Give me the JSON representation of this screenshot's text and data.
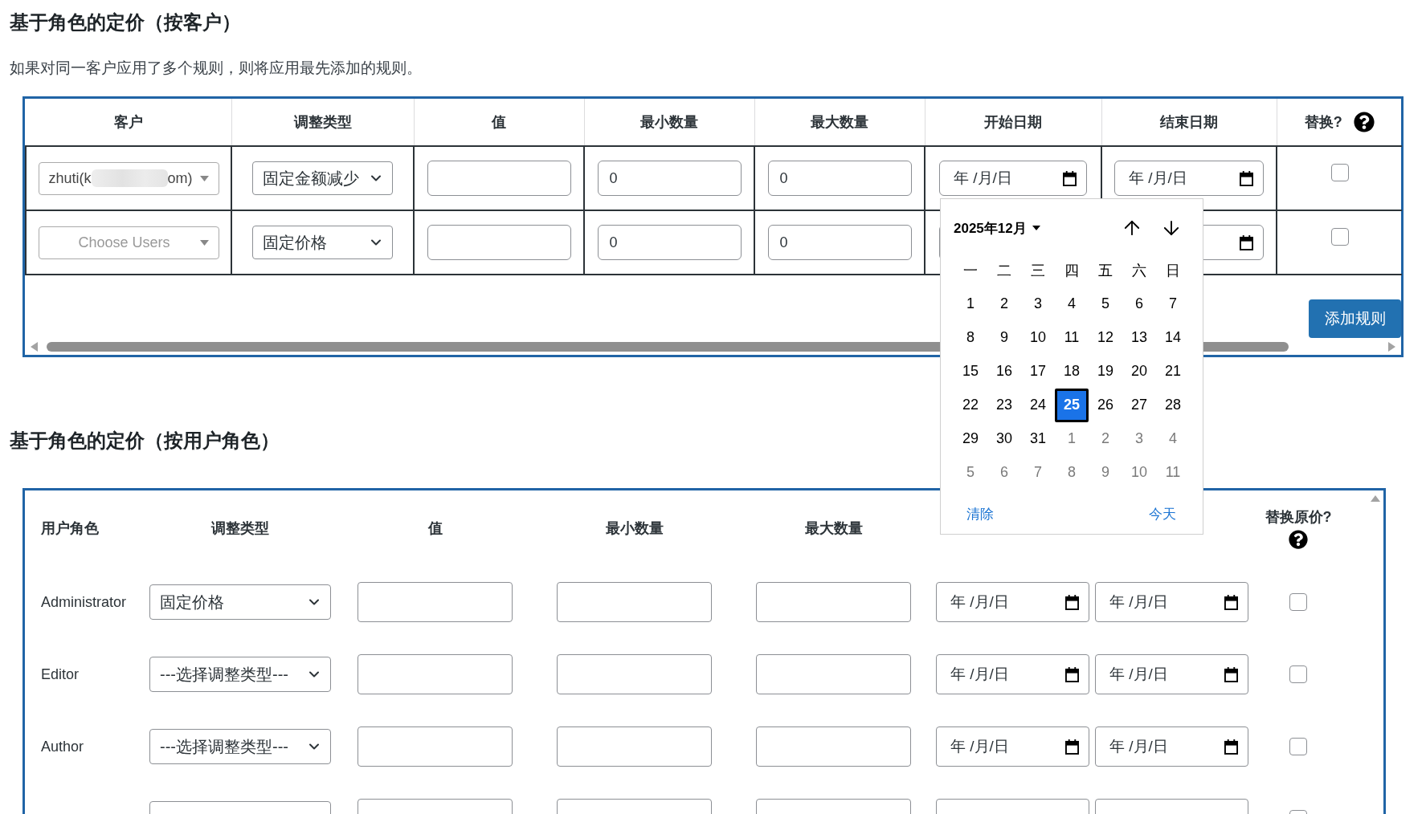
{
  "customer_pricing": {
    "title": "基于角色的定价（按客户）",
    "note": "如果对同一客户应用了多个规则，则将应用最先添加的规则。",
    "columns": [
      {
        "label": "客户",
        "help": false
      },
      {
        "label": "调整类型",
        "help": false
      },
      {
        "label": "值",
        "help": false
      },
      {
        "label": "最小数量",
        "help": false
      },
      {
        "label": "最大数量",
        "help": false
      },
      {
        "label": "开始日期",
        "help": false
      },
      {
        "label": "结束日期",
        "help": false
      },
      {
        "label": "替换?",
        "help": true
      }
    ],
    "rows": [
      {
        "customer": {
          "text_start": "zhuti(k",
          "redacted": true,
          "text_end": "om)"
        },
        "adjustment": "固定金额减少",
        "min_qty": "0",
        "max_qty": "0",
        "start_date": "年 /月/日",
        "end_date": "年 /月/日",
        "replace": false
      },
      {
        "customer": {
          "placeholder": "Choose Users"
        },
        "adjustment": "固定价格",
        "min_qty": "0",
        "max_qty": "0",
        "replace": false
      }
    ],
    "add_button": "添加规则"
  },
  "date_picker": {
    "month": "2025年12月",
    "weekdays": [
      "一",
      "二",
      "三",
      "四",
      "五",
      "六",
      "日"
    ],
    "days": [
      {
        "label": "1",
        "outside": false,
        "selected": false
      },
      {
        "label": "2",
        "outside": false,
        "selected": false
      },
      {
        "label": "3",
        "outside": false,
        "selected": false
      },
      {
        "label": "4",
        "outside": false,
        "selected": false
      },
      {
        "label": "5",
        "outside": false,
        "selected": false
      },
      {
        "label": "6",
        "outside": false,
        "selected": false
      },
      {
        "label": "7",
        "outside": false,
        "selected": false
      },
      {
        "label": "8",
        "outside": false,
        "selected": false
      },
      {
        "label": "9",
        "outside": false,
        "selected": false
      },
      {
        "label": "10",
        "outside": false,
        "selected": false
      },
      {
        "label": "11",
        "outside": false,
        "selected": false
      },
      {
        "label": "12",
        "outside": false,
        "selected": false
      },
      {
        "label": "13",
        "outside": false,
        "selected": false
      },
      {
        "label": "14",
        "outside": false,
        "selected": false
      },
      {
        "label": "15",
        "outside": false,
        "selected": false
      },
      {
        "label": "16",
        "outside": false,
        "selected": false
      },
      {
        "label": "17",
        "outside": false,
        "selected": false
      },
      {
        "label": "18",
        "outside": false,
        "selected": false
      },
      {
        "label": "19",
        "outside": false,
        "selected": false
      },
      {
        "label": "20",
        "outside": false,
        "selected": false
      },
      {
        "label": "21",
        "outside": false,
        "selected": false
      },
      {
        "label": "22",
        "outside": false,
        "selected": false
      },
      {
        "label": "23",
        "outside": false,
        "selected": false
      },
      {
        "label": "24",
        "outside": false,
        "selected": false
      },
      {
        "label": "25",
        "outside": false,
        "selected": true
      },
      {
        "label": "26",
        "outside": false,
        "selected": false
      },
      {
        "label": "27",
        "outside": false,
        "selected": false
      },
      {
        "label": "28",
        "outside": false,
        "selected": false
      },
      {
        "label": "29",
        "outside": false,
        "selected": false
      },
      {
        "label": "30",
        "outside": false,
        "selected": false
      },
      {
        "label": "31",
        "outside": false,
        "selected": false
      },
      {
        "label": "1",
        "outside": true,
        "selected": false
      },
      {
        "label": "2",
        "outside": true,
        "selected": false
      },
      {
        "label": "3",
        "outside": true,
        "selected": false
      },
      {
        "label": "4",
        "outside": true,
        "selected": false
      },
      {
        "label": "5",
        "outside": true,
        "selected": false
      },
      {
        "label": "6",
        "outside": true,
        "selected": false
      },
      {
        "label": "7",
        "outside": true,
        "selected": false
      },
      {
        "label": "8",
        "outside": true,
        "selected": false
      },
      {
        "label": "9",
        "outside": true,
        "selected": false
      },
      {
        "label": "10",
        "outside": true,
        "selected": false
      },
      {
        "label": "11",
        "outside": true,
        "selected": false
      }
    ],
    "clear": "清除",
    "today": "今天"
  },
  "role_pricing": {
    "title": "基于角色的定价（按用户角色）",
    "columns": [
      {
        "label": "用户角色",
        "help": false
      },
      {
        "label": "调整类型",
        "help": false
      },
      {
        "label": "值",
        "help": false
      },
      {
        "label": "最小数量",
        "help": false
      },
      {
        "label": "最大数量",
        "help": false
      },
      {
        "label": "替换原价?",
        "help": true
      }
    ],
    "rows": [
      {
        "kind": "full",
        "role": "Administrator",
        "adjustment": "固定价格",
        "start_date": "年 /月/日",
        "end_date": "年 /月/日",
        "replace": false
      },
      {
        "kind": "full",
        "role": "Editor",
        "adjustment": "---选择调整类型---",
        "start_date": "年 /月/日",
        "end_date": "年 /月/日",
        "replace": false
      },
      {
        "kind": "full",
        "role": "Author",
        "adjustment": "---选择调整类型---",
        "start_date": "年 /月/日",
        "end_date": "年 /月/日",
        "replace": false
      },
      {
        "kind": "cut",
        "replace": false
      }
    ]
  }
}
